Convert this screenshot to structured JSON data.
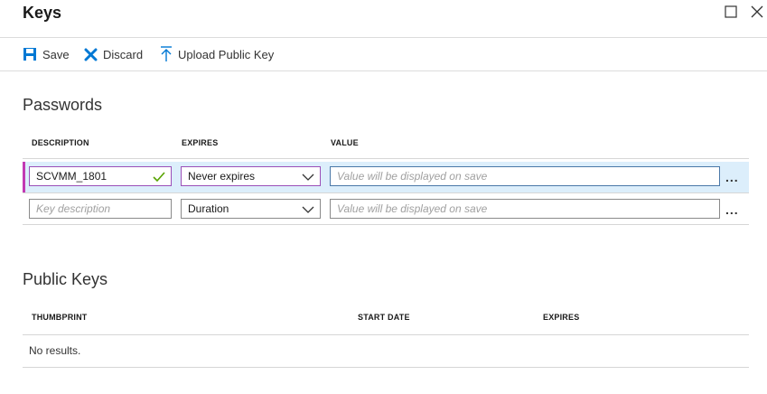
{
  "window": {
    "title": "Keys"
  },
  "toolbar": {
    "save_label": "Save",
    "discard_label": "Discard",
    "upload_label": "Upload Public Key"
  },
  "passwords": {
    "title": "Passwords",
    "columns": {
      "description": "DESCRIPTION",
      "expires": "EXPIRES",
      "value": "VALUE"
    },
    "rows": [
      {
        "description": "SCVMM_1801",
        "expires": "Never expires",
        "value_placeholder": "Value will be displayed on save",
        "more": "..."
      },
      {
        "description_placeholder": "Key description",
        "expires": "Duration",
        "value_placeholder": "Value will be displayed on save",
        "more": "..."
      }
    ]
  },
  "public_keys": {
    "title": "Public Keys",
    "columns": {
      "thumbprint": "THUMBPRINT",
      "start_date": "START DATE",
      "expires": "EXPIRES"
    },
    "empty_text": "No results."
  },
  "colors": {
    "accent": "#0078d4",
    "row_highlight": "#dceefb",
    "row_marker": "#c239b3",
    "valid_check": "#57a300"
  },
  "icons": [
    "maximize-icon",
    "close-icon",
    "save-icon",
    "discard-icon",
    "upload-icon",
    "checkmark-icon",
    "chevron-down-icon"
  ]
}
